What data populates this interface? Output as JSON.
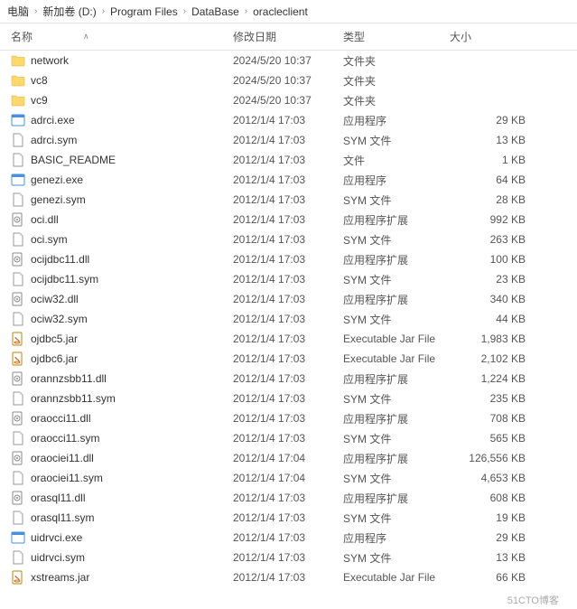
{
  "breadcrumb": [
    "电脑",
    "新加卷 (D:)",
    "Program Files",
    "DataBase",
    "oracleclient"
  ],
  "columns": {
    "name": "名称",
    "date": "修改日期",
    "type": "类型",
    "size": "大小"
  },
  "watermark": "51CTO博客",
  "files": [
    {
      "name": "network",
      "date": "2024/5/20 10:37",
      "type": "文件夹",
      "size": "",
      "icon": "folder"
    },
    {
      "name": "vc8",
      "date": "2024/5/20 10:37",
      "type": "文件夹",
      "size": "",
      "icon": "folder"
    },
    {
      "name": "vc9",
      "date": "2024/5/20 10:37",
      "type": "文件夹",
      "size": "",
      "icon": "folder"
    },
    {
      "name": "adrci.exe",
      "date": "2012/1/4 17:03",
      "type": "应用程序",
      "size": "29 KB",
      "icon": "exe"
    },
    {
      "name": "adrci.sym",
      "date": "2012/1/4 17:03",
      "type": "SYM 文件",
      "size": "13 KB",
      "icon": "file"
    },
    {
      "name": "BASIC_README",
      "date": "2012/1/4 17:03",
      "type": "文件",
      "size": "1 KB",
      "icon": "file"
    },
    {
      "name": "genezi.exe",
      "date": "2012/1/4 17:03",
      "type": "应用程序",
      "size": "64 KB",
      "icon": "exe"
    },
    {
      "name": "genezi.sym",
      "date": "2012/1/4 17:03",
      "type": "SYM 文件",
      "size": "28 KB",
      "icon": "file"
    },
    {
      "name": "oci.dll",
      "date": "2012/1/4 17:03",
      "type": "应用程序扩展",
      "size": "992 KB",
      "icon": "dll"
    },
    {
      "name": "oci.sym",
      "date": "2012/1/4 17:03",
      "type": "SYM 文件",
      "size": "263 KB",
      "icon": "file"
    },
    {
      "name": "ocijdbc11.dll",
      "date": "2012/1/4 17:03",
      "type": "应用程序扩展",
      "size": "100 KB",
      "icon": "dll"
    },
    {
      "name": "ocijdbc11.sym",
      "date": "2012/1/4 17:03",
      "type": "SYM 文件",
      "size": "23 KB",
      "icon": "file"
    },
    {
      "name": "ociw32.dll",
      "date": "2012/1/4 17:03",
      "type": "应用程序扩展",
      "size": "340 KB",
      "icon": "dll"
    },
    {
      "name": "ociw32.sym",
      "date": "2012/1/4 17:03",
      "type": "SYM 文件",
      "size": "44 KB",
      "icon": "file"
    },
    {
      "name": "ojdbc5.jar",
      "date": "2012/1/4 17:03",
      "type": "Executable Jar File",
      "size": "1,983 KB",
      "icon": "jar"
    },
    {
      "name": "ojdbc6.jar",
      "date": "2012/1/4 17:03",
      "type": "Executable Jar File",
      "size": "2,102 KB",
      "icon": "jar"
    },
    {
      "name": "orannzsbb11.dll",
      "date": "2012/1/4 17:03",
      "type": "应用程序扩展",
      "size": "1,224 KB",
      "icon": "dll"
    },
    {
      "name": "orannzsbb11.sym",
      "date": "2012/1/4 17:03",
      "type": "SYM 文件",
      "size": "235 KB",
      "icon": "file"
    },
    {
      "name": "oraocci11.dll",
      "date": "2012/1/4 17:03",
      "type": "应用程序扩展",
      "size": "708 KB",
      "icon": "dll"
    },
    {
      "name": "oraocci11.sym",
      "date": "2012/1/4 17:03",
      "type": "SYM 文件",
      "size": "565 KB",
      "icon": "file"
    },
    {
      "name": "oraociei11.dll",
      "date": "2012/1/4 17:04",
      "type": "应用程序扩展",
      "size": "126,556 KB",
      "icon": "dll"
    },
    {
      "name": "oraociei11.sym",
      "date": "2012/1/4 17:04",
      "type": "SYM 文件",
      "size": "4,653 KB",
      "icon": "file"
    },
    {
      "name": "orasql11.dll",
      "date": "2012/1/4 17:03",
      "type": "应用程序扩展",
      "size": "608 KB",
      "icon": "dll"
    },
    {
      "name": "orasql11.sym",
      "date": "2012/1/4 17:03",
      "type": "SYM 文件",
      "size": "19 KB",
      "icon": "file"
    },
    {
      "name": "uidrvci.exe",
      "date": "2012/1/4 17:03",
      "type": "应用程序",
      "size": "29 KB",
      "icon": "exe"
    },
    {
      "name": "uidrvci.sym",
      "date": "2012/1/4 17:03",
      "type": "SYM 文件",
      "size": "13 KB",
      "icon": "file"
    },
    {
      "name": "xstreams.jar",
      "date": "2012/1/4 17:03",
      "type": "Executable Jar File",
      "size": "66 KB",
      "icon": "jar"
    }
  ]
}
